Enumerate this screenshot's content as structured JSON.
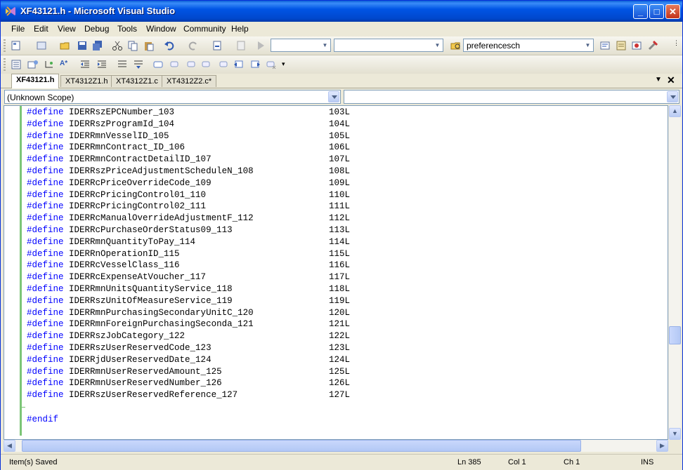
{
  "window": {
    "title": "XF43121.h - Microsoft Visual Studio"
  },
  "menu": [
    "File",
    "Edit",
    "View",
    "Debug",
    "Tools",
    "Window",
    "Community",
    "Help"
  ],
  "toolbar": {
    "find_combo_value": "preferencesch"
  },
  "tabs": [
    {
      "label": "XF43121.h",
      "active": true
    },
    {
      "label": "XT4312Z1.h",
      "active": false
    },
    {
      "label": "XT4312Z1.c",
      "active": false
    },
    {
      "label": "XT4312Z2.c*",
      "active": false
    }
  ],
  "scope": {
    "left_value": "(Unknown Scope)",
    "right_value": ""
  },
  "code": {
    "keyword": "#define",
    "lines": [
      {
        "name": "IDERRszEPCNumber_103",
        "value": "103L"
      },
      {
        "name": "IDERRszProgramId_104",
        "value": "104L"
      },
      {
        "name": "IDERRmnVesselID_105",
        "value": "105L"
      },
      {
        "name": "IDERRmnContract_ID_106",
        "value": "106L"
      },
      {
        "name": "IDERRmnContractDetailID_107",
        "value": "107L"
      },
      {
        "name": "IDERRszPriceAdjustmentScheduleN_108",
        "value": "108L"
      },
      {
        "name": "IDERRcPriceOverrideCode_109",
        "value": "109L"
      },
      {
        "name": "IDERRcPricingControl01_110",
        "value": "110L"
      },
      {
        "name": "IDERRcPricingControl02_111",
        "value": "111L"
      },
      {
        "name": "IDERRcManualOverrideAdjustmentF_112",
        "value": "112L"
      },
      {
        "name": "IDERRcPurchaseOrderStatus09_113",
        "value": "113L"
      },
      {
        "name": "IDERRmnQuantityToPay_114",
        "value": "114L"
      },
      {
        "name": "IDERRnOperationID_115",
        "value": "115L"
      },
      {
        "name": "IDERRcVesselClass_116",
        "value": "116L"
      },
      {
        "name": "IDERRcExpenseAtVoucher_117",
        "value": "117L"
      },
      {
        "name": "IDERRmnUnitsQuantityService_118",
        "value": "118L"
      },
      {
        "name": "IDERRszUnitOfMeasureService_119",
        "value": "119L"
      },
      {
        "name": "IDERRmnPurchasingSecondaryUnitC_120",
        "value": "120L"
      },
      {
        "name": "IDERRmnForeignPurchasingSeconda_121",
        "value": "121L"
      },
      {
        "name": "IDERRszJobCategory_122",
        "value": "122L"
      },
      {
        "name": "IDERRszUserReservedCode_123",
        "value": "123L"
      },
      {
        "name": "IDERRjdUserReservedDate_124",
        "value": "124L"
      },
      {
        "name": "IDERRmnUserReservedAmount_125",
        "value": "125L"
      },
      {
        "name": "IDERRmnUserReservedNumber_126",
        "value": "126L"
      },
      {
        "name": "IDERRszUserReservedReference_127",
        "value": "127L"
      }
    ],
    "endif": "#endif"
  },
  "status": {
    "message": "Item(s) Saved",
    "line": "Ln 385",
    "col": "Col 1",
    "ch": "Ch 1",
    "mode": "INS"
  }
}
